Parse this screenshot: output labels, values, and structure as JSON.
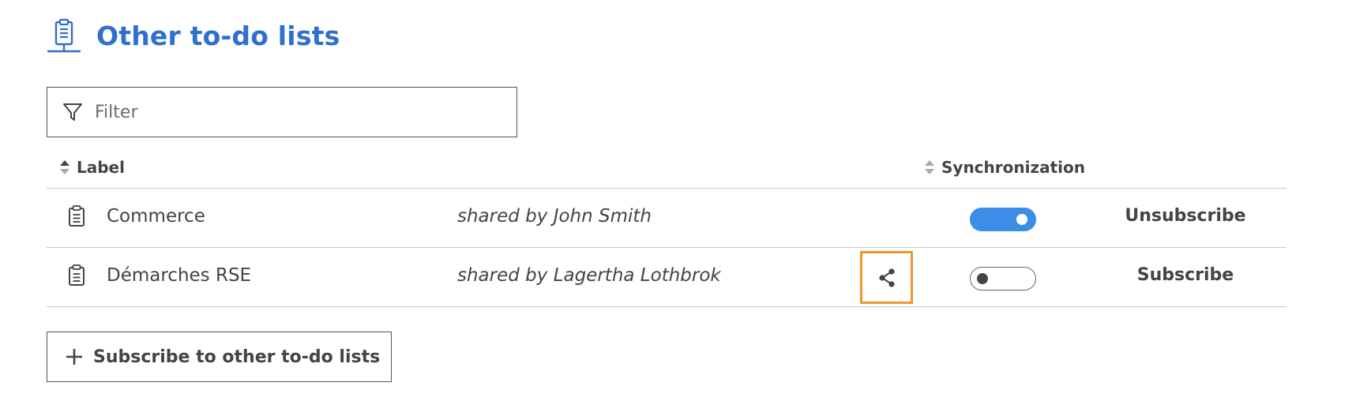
{
  "header": {
    "title": "Other to-do lists",
    "icon": "clipboard-list-icon",
    "accent_color": "#2f6fce"
  },
  "filter": {
    "placeholder": "Filter",
    "value": "",
    "icon": "filter-funnel-icon"
  },
  "table": {
    "columns": {
      "label": "Label",
      "synchronization": "Synchronization"
    },
    "rows": [
      {
        "label": "Commerce",
        "shared_by": "shared by John Smith",
        "share_icon_visible": false,
        "synchronized": true,
        "action": "Unsubscribe"
      },
      {
        "label": "Démarches RSE",
        "shared_by": "shared by Lagertha Lothbrok",
        "share_icon_visible": true,
        "synchronized": false,
        "action": "Subscribe"
      }
    ]
  },
  "subscribe_button": {
    "label": "Subscribe to other to-do lists",
    "icon": "plus-icon"
  },
  "colors": {
    "toggle_on": "#3b8de8",
    "highlight_border": "#f0962f"
  }
}
